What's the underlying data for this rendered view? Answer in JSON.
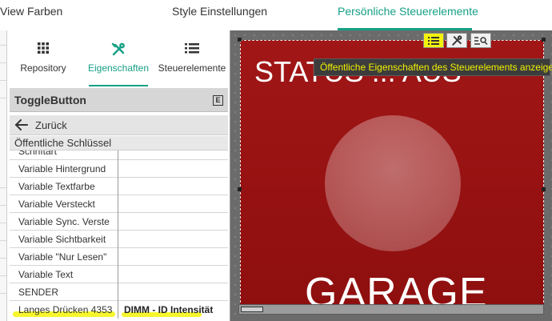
{
  "top_tabs": [
    {
      "label": "View Farben"
    },
    {
      "label": "Style Einstellungen"
    },
    {
      "label": "Persönliche Steuerelemente"
    }
  ],
  "panel_tabs": [
    {
      "label": "Repository",
      "icon": "grid-icon"
    },
    {
      "label": "Eigenschaften",
      "icon": "tools-icon"
    },
    {
      "label": "Steuerelemente",
      "icon": "list-icon"
    }
  ],
  "panel": {
    "title": "ToggleButton",
    "title_button": "E",
    "back_label": "Zurück",
    "section_label": "Öffentliche Schlüssel"
  },
  "property_rows": [
    {
      "key": "Schriftart",
      "value": ""
    },
    {
      "key": "Variable Hintergrund",
      "value": ""
    },
    {
      "key": "Variable Textfarbe",
      "value": ""
    },
    {
      "key": "Variable Versteckt",
      "value": ""
    },
    {
      "key": "Variable Sync. Verste",
      "value": ""
    },
    {
      "key": "Variable Sichtbarkeit",
      "value": ""
    },
    {
      "key": "Variable \"Nur Lesen\"",
      "value": ""
    },
    {
      "key": "Variable Text",
      "value": ""
    },
    {
      "key": "SENDER",
      "value": ""
    },
    {
      "key": "Langes Drücken 4353",
      "value": "DIMM - ID Intensität"
    }
  ],
  "canvas": {
    "status_text": "STATUS ... AUS",
    "big_text": "GARAGE",
    "tooltip": "Öffentliche Eigenschaften des Steuerelements anzeigen",
    "accent_color": "#16a085",
    "widget_color": "#9a1414",
    "highlight_color": "#f4f40a"
  }
}
